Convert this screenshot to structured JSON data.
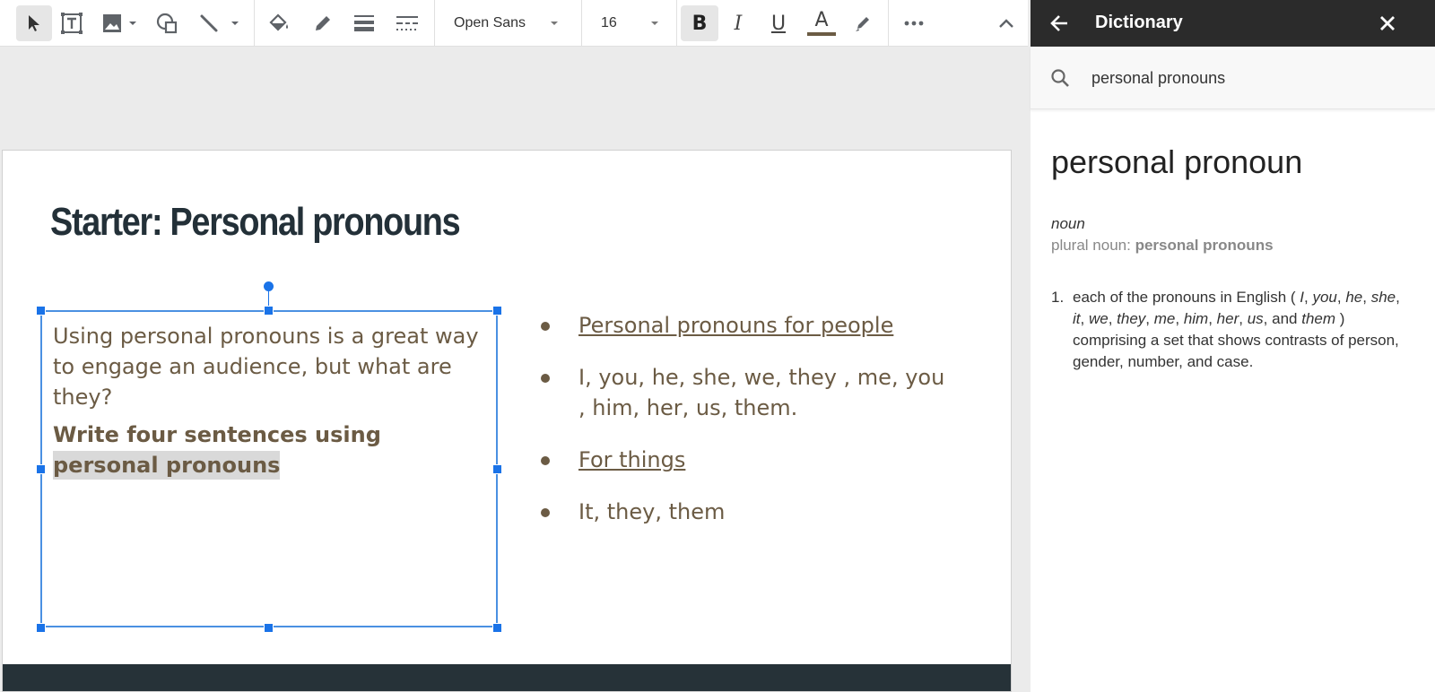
{
  "toolbar": {
    "font_name": "Open Sans",
    "font_size": "16",
    "bold_letter": "B",
    "italic_letter": "I",
    "underline_letter": "U",
    "text_color_letter": "A",
    "text_color_hex": "#6b5b44"
  },
  "slide": {
    "title": "Starter: Personal pronouns",
    "textbox": {
      "para1": "Using personal pronouns is a great way to engage an audience, but what are they?",
      "para2_plain": "Write four sentences using ",
      "para2_highlight": "personal pronouns"
    },
    "bullets": [
      {
        "text": "Personal pronouns for people",
        "underlined": true
      },
      {
        "text": "I, you, he, she, we, they , me, you , him, her, us, them.",
        "underlined": false
      },
      {
        "text": "For things",
        "underlined": true
      },
      {
        "text": "It, they, them",
        "underlined": false
      }
    ]
  },
  "dictionary": {
    "panel_title": "Dictionary",
    "search_value": "personal pronouns",
    "word": "personal pronoun",
    "part_of_speech": "noun",
    "plural_label": "plural noun: ",
    "plural_value": "personal pronouns",
    "definition_number": "1.",
    "definition": {
      "intro": "each of the pronouns in English ( ",
      "p_i": "I",
      "p_you": "you",
      "p_he": "he",
      "p_she": "she",
      "p_it": "it",
      "p_we": "we",
      "p_they": "they",
      "p_me": "me",
      "p_him": "him",
      "p_her": "her",
      "p_us": "us",
      "and_word": "and",
      "p_them": "them",
      "outro": " ) comprising a set that shows contrasts of person, gender, number, and case."
    }
  },
  "colors": {
    "accent_blue": "#1a73e8",
    "title_dark": "#233038",
    "body_brown": "#6b5b44",
    "panel_header": "#2b2b2b",
    "slide_footer": "#263238"
  }
}
